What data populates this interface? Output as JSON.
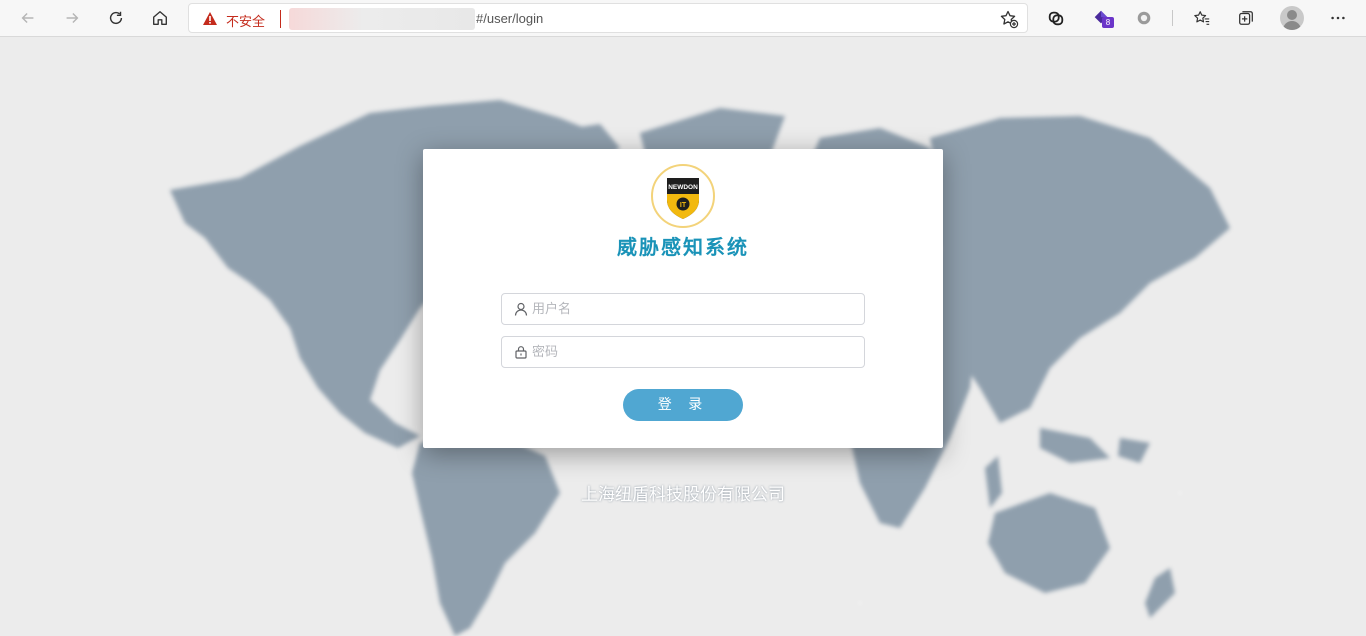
{
  "browser": {
    "security_label": "不安全",
    "url_path": "#/user/login",
    "extension_badge": "8",
    "icons": {
      "back": "arrow-left-icon",
      "forward": "arrow-right-icon",
      "refresh": "refresh-icon",
      "home": "home-icon",
      "warning": "warning-triangle-icon",
      "add_favorite": "star-plus-icon",
      "extensions": [
        "link-extension-icon",
        "purple-gem-extension-icon",
        "circle-extension-icon"
      ],
      "favorites": "favorites-icon",
      "collections": "collections-icon",
      "profile": "avatar-icon",
      "menu": "more-icon"
    }
  },
  "login": {
    "logo_text": "NEWDON",
    "logo_badge": "IT",
    "title": "威胁感知系统",
    "username_placeholder": "用户名",
    "password_placeholder": "密码",
    "submit_label": "登 录"
  },
  "footer": {
    "company": "上海纽盾科技股份有限公司"
  },
  "colors": {
    "accent": "#50a7d2",
    "title": "#1a93b8",
    "map": "#8f9fad",
    "background": "#ececec",
    "insecure": "#c42b1c"
  }
}
